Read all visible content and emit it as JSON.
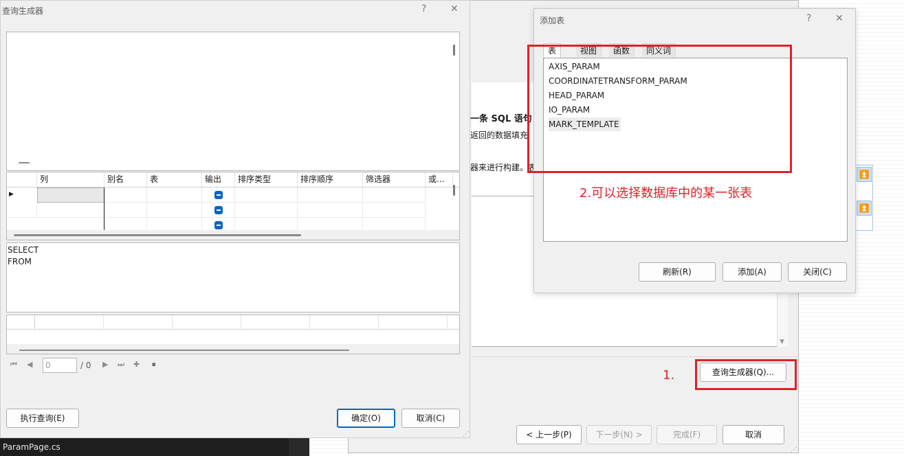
{
  "query_builder": {
    "title": "查询生成器",
    "help": "?",
    "close": "✕",
    "grid_columns": [
      "列",
      "别名",
      "表",
      "输出",
      "排序类型",
      "排序顺序",
      "筛选器",
      "或..."
    ],
    "sql_text": [
      "SELECT",
      "FROM"
    ],
    "pager": {
      "page_value": "0",
      "total": "/ 0"
    },
    "buttons": {
      "execute": "执行查询(E)",
      "ok": "确定(O)",
      "cancel": "取消(C)"
    }
  },
  "wizard": {
    "lines": {
      "heading": "一条 SQL 语句",
      "line1": "返回的数据填充",
      "line2": "器来进行构建。表"
    },
    "query_builder_button": "查询生成器(Q)...",
    "nav": {
      "prev": "< 上一步(P)",
      "next": "下一步(N) >",
      "finish": "完成(F)",
      "cancel": "取消"
    }
  },
  "add_table": {
    "title": "添加表",
    "help": "?",
    "close": "✕",
    "tabs": [
      "表",
      "视图",
      "函数",
      "同义词"
    ],
    "tables": [
      "AXIS_PARAM",
      "COORDINATETRANSFORM_PARAM",
      "HEAD_PARAM",
      "IO_PARAM",
      "MARK_TEMPLATE"
    ],
    "buttons": {
      "refresh": "刷新(R)",
      "add": "添加(A)",
      "close": "关闭(C)"
    }
  },
  "annotations": {
    "step1": "1.",
    "step2": "2.可以选择数据库中的某一张表"
  },
  "side_icons": [
    "collapse-up-icon",
    "collapse-up-icon"
  ],
  "taskbar": {
    "file": "ParamPage.cs"
  },
  "colors": {
    "annotation_red": "#e0202a",
    "accent_blue": "#0067c0",
    "checkbox_blue": "#0a64c8"
  }
}
